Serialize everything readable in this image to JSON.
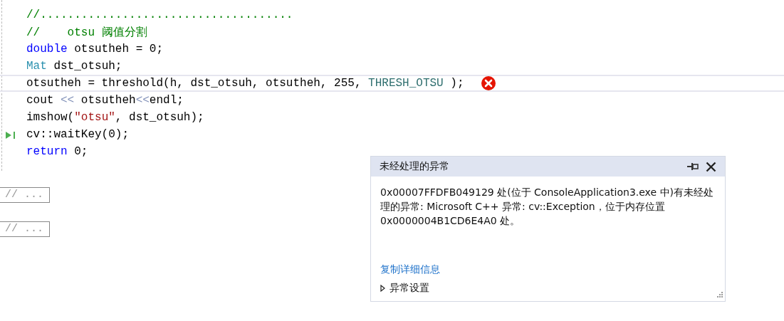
{
  "code": {
    "lines": [
      {
        "highlighted": false,
        "error": false,
        "current": false,
        "tokens": [
          {
            "text": "//.....................................",
            "kind": "comment"
          }
        ]
      },
      {
        "highlighted": false,
        "error": false,
        "current": false,
        "tokens": [
          {
            "text": "//    otsu 阈值分割",
            "kind": "comment"
          }
        ]
      },
      {
        "highlighted": false,
        "error": false,
        "current": false,
        "tokens": [
          {
            "text": "double",
            "kind": "keyword"
          },
          {
            "text": " otsutheh = 0;",
            "kind": "plain"
          }
        ]
      },
      {
        "highlighted": false,
        "error": false,
        "current": false,
        "tokens": [
          {
            "text": "Mat",
            "kind": "type"
          },
          {
            "text": " dst_otsuh;",
            "kind": "plain"
          }
        ]
      },
      {
        "highlighted": true,
        "error": true,
        "current": false,
        "tokens": [
          {
            "text": "otsutheh = threshold(h, dst_otsuh, otsutheh, 255, ",
            "kind": "plain"
          },
          {
            "text": "THRESH_OTSU",
            "kind": "macro"
          },
          {
            "text": " );",
            "kind": "plain"
          }
        ]
      },
      {
        "highlighted": false,
        "error": false,
        "current": false,
        "tokens": [
          {
            "text": "cout ",
            "kind": "plain"
          },
          {
            "text": "<<",
            "kind": "operator"
          },
          {
            "text": " otsutheh",
            "kind": "plain"
          },
          {
            "text": "<<",
            "kind": "operator"
          },
          {
            "text": "endl;",
            "kind": "plain"
          }
        ]
      },
      {
        "highlighted": false,
        "error": false,
        "current": false,
        "tokens": [
          {
            "text": "imshow(",
            "kind": "plain"
          },
          {
            "text": "\"otsu\"",
            "kind": "string"
          },
          {
            "text": ", dst_otsuh);",
            "kind": "plain"
          }
        ]
      },
      {
        "highlighted": false,
        "error": false,
        "current": true,
        "tokens": [
          {
            "text": "cv::waitKey(0);",
            "kind": "plain"
          }
        ]
      },
      {
        "highlighted": false,
        "error": false,
        "current": false,
        "tokens": [
          {
            "text": "return",
            "kind": "keyword"
          },
          {
            "text": " 0;",
            "kind": "plain"
          }
        ]
      }
    ],
    "collapsed": [
      "// ...",
      "// ..."
    ]
  },
  "popup": {
    "title": "未经处理的异常",
    "message": "0x00007FFDFB049129 处(位于 ConsoleApplication3.exe 中)有未经处理的异常: Microsoft C++ 异常: cv::Exception，位于内存位置 0x0000004B1CD6E4A0 处。",
    "link": "复制详细信息",
    "section": {
      "label": "异常设置",
      "expanded": false
    }
  }
}
